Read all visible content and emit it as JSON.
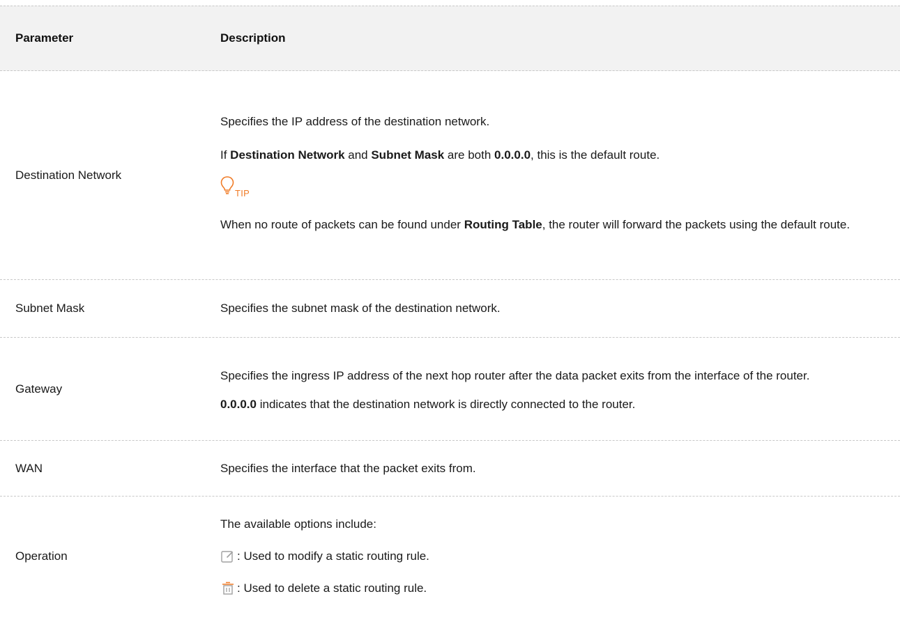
{
  "header": {
    "parameter": "Parameter",
    "description": "Description"
  },
  "rows": {
    "destination_network": {
      "name": "Destination Network",
      "line1": "Specifies the IP address of the destination network.",
      "line2_prefix": "If ",
      "line2_bold1": "Destination Network",
      "line2_mid1": " and ",
      "line2_bold2": "Subnet Mask",
      "line2_mid2": " are both ",
      "line2_bold3": "0.0.0.0",
      "line2_suffix": ", this is the default route.",
      "tip_icon": "lightbulb-icon",
      "tip_label": "TIP",
      "tip_prefix": "When no route of packets can be found under ",
      "tip_bold": "Routing Table",
      "tip_suffix": ", the router will forward the packets using the default route."
    },
    "subnet_mask": {
      "name": "Subnet Mask",
      "desc": "Specifies the subnet mask of the destination network."
    },
    "gateway": {
      "name": "Gateway",
      "desc1": "Specifies the ingress IP address of the next hop router after the data packet exits from the interface of the router.",
      "desc2_bold": "0.0.0.0",
      "desc2_suffix": " indicates that the destination network is directly connected to the router."
    },
    "wan": {
      "name": "WAN",
      "desc": "Specifies the interface that the packet exits from."
    },
    "operation": {
      "name": "Operation",
      "intro": "The available options include:",
      "edit_icon": "edit-icon",
      "edit_desc": ": Used to modify a static routing rule.",
      "delete_icon": "trash-icon",
      "delete_desc": ": Used to delete a static routing rule."
    }
  },
  "colors": {
    "header_bg": "#f2f2f2",
    "tip_accent": "#f07b26",
    "icon_gray": "#a0a0a0",
    "divider": "#c8c8c8"
  }
}
